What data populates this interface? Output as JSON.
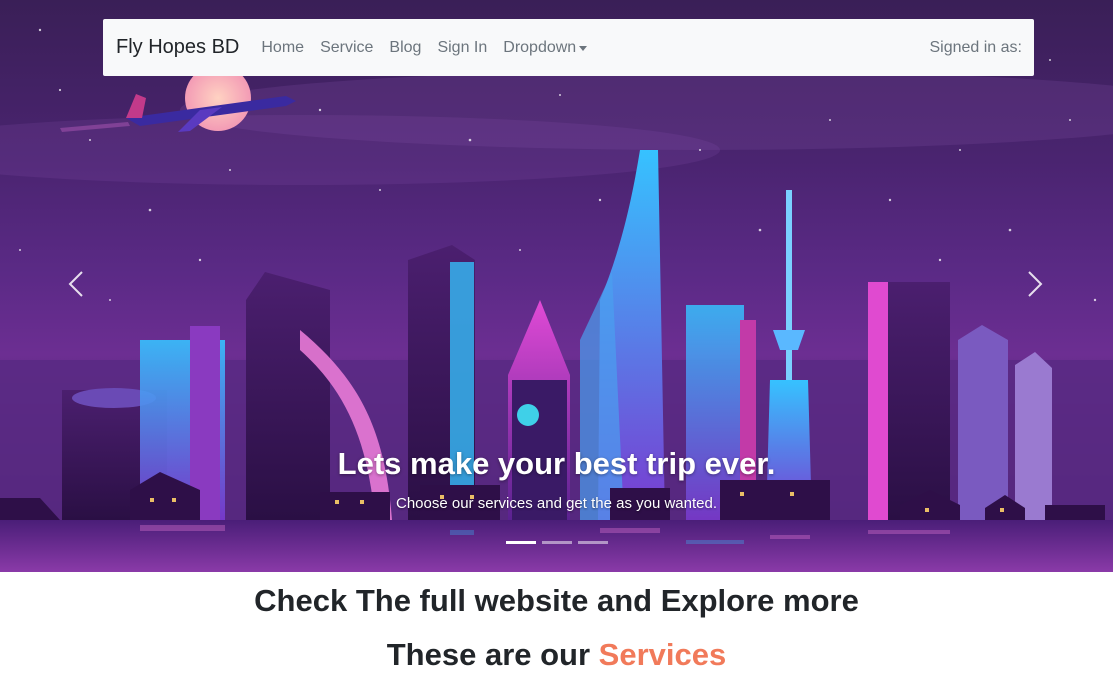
{
  "navbar": {
    "brand": "Fly Hopes BD",
    "links": [
      "Home",
      "Service",
      "Blog",
      "Sign In"
    ],
    "dropdown_label": "Dropdown",
    "signed_in": "Signed in as:"
  },
  "carousel": {
    "title": "Lets make your best trip ever.",
    "text": "Choose our services and get the as you wanted.",
    "slide_count": 3,
    "active_slide": 1
  },
  "content": {
    "headline": "Check The full website and Explore more",
    "services_prefix": "These are our ",
    "services_accent": "Services"
  },
  "colors": {
    "accent": "#f17a5a",
    "navbar_bg": "#f8f9fa"
  }
}
